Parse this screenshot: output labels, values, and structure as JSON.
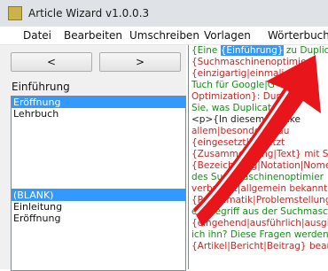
{
  "window": {
    "title": "Article Wizard v1.0.0.3"
  },
  "menu": {
    "items": [
      "Datei",
      "Bearbeiten",
      "Umschreiben",
      "Vorlagen",
      "Wörterbuch"
    ]
  },
  "nav": {
    "prev": "<",
    "next": ">"
  },
  "structure": {
    "label": "Einführung",
    "top_list": {
      "items": [
        "Eröffnung",
        "Lehrbuch"
      ],
      "selected_index": 0
    },
    "bottom_list": {
      "items": [
        "(BLANK)",
        "Einleitung",
        "Eröffnung"
      ],
      "selected_index": 0
    }
  },
  "editor": {
    "lines": [
      {
        "pre": "{Eine ",
        "highlight": "{Einführung}",
        "post": " zu Duplicate"
      },
      {
        "pre": "{Suchmaschinenoptimier",
        "highlight": "",
        "post": ""
      },
      {
        "pre": "{einzigartig|einmalig",
        "highlight": "",
        "post": ""
      },
      {
        "pre": "Tuch für Google|G",
        "highlight": "",
        "post": ""
      },
      {
        "pre": "Optimization}: Dup",
        "highlight": "",
        "post": ""
      },
      {
        "pre": "Sie, was Duplicate C",
        "highlight": "",
        "post": ""
      },
      {
        "pre": "<p>{In diesem {Artike",
        "highlight": "",
        "post": ""
      },
      {
        "pre": "allem|besonders|hau",
        "highlight": "",
        "post": ""
      },
      {
        "pre": "{eingesetzt|benutzt",
        "highlight": "",
        "post": ""
      },
      {
        "pre": "{Zusammenhang|Text} mit Su",
        "highlight": "",
        "post": ""
      },
      {
        "pre": "{Bezeichnung|Notation|Nomenkl",
        "highlight": "",
        "post": ""
      },
      {
        "pre": "des Suchmaschinenoptimier",
        "highlight": "",
        "post": ""
      },
      {
        "pre": "verbreitet|allgemein bekannt}. {Di",
        "highlight": "",
        "post": ""
      },
      {
        "pre": "{Problematik|Problemstellung}. D",
        "highlight": "",
        "post": ""
      },
      {
        "pre": "ein Begriff aus der Suchmaschin",
        "highlight": "",
        "post": ""
      },
      {
        "pre": "{eingehend|ausführlich|ausgiebig",
        "highlight": "",
        "post": ""
      },
      {
        "pre": "ich ihn? Diese Fragen werden in",
        "highlight": "",
        "post": ""
      },
      {
        "pre": "{Artikel|Bericht|Beitrag} beantwor",
        "highlight": "",
        "post": ""
      }
    ]
  },
  "colors": {
    "accent": "#3399ff",
    "arrow": "#e8161b",
    "synonym": "#d62020",
    "text_green": "#129112"
  }
}
